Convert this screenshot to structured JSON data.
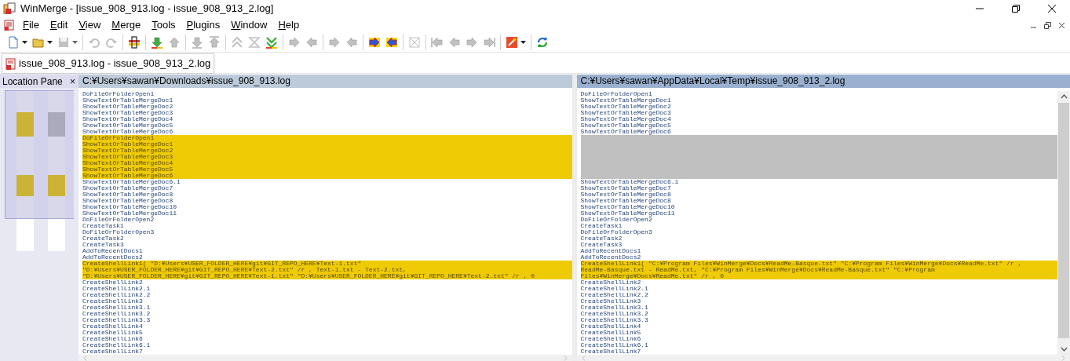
{
  "window": {
    "title": "WinMerge - [issue_908_913.log - issue_908_913_2.log]"
  },
  "menu": [
    {
      "label": "File"
    },
    {
      "label": "Edit"
    },
    {
      "label": "View"
    },
    {
      "label": "Merge"
    },
    {
      "label": "Tools"
    },
    {
      "label": "Plugins"
    },
    {
      "label": "Window"
    },
    {
      "label": "Help"
    }
  ],
  "toolbar": [
    {
      "kind": "new",
      "disabled": false,
      "dropdown": true
    },
    {
      "kind": "open",
      "disabled": false,
      "dropdown": true
    },
    {
      "kind": "save",
      "disabled": true,
      "dropdown": true
    },
    {
      "kind": "separator"
    },
    {
      "kind": "undo",
      "disabled": true
    },
    {
      "kind": "redo",
      "disabled": true
    },
    {
      "kind": "separator"
    },
    {
      "kind": "options",
      "disabled": false
    },
    {
      "kind": "separator"
    },
    {
      "kind": "next-diff",
      "disabled": false
    },
    {
      "kind": "prev-diff",
      "disabled": true
    },
    {
      "kind": "separator"
    },
    {
      "kind": "last-diff",
      "disabled": true
    },
    {
      "kind": "first-diff",
      "disabled": true
    },
    {
      "kind": "separator"
    },
    {
      "kind": "prev-conflict",
      "disabled": true
    },
    {
      "kind": "current-diff",
      "disabled": true
    },
    {
      "kind": "next-conflict",
      "disabled": false
    },
    {
      "kind": "separator"
    },
    {
      "kind": "copy-right",
      "disabled": true
    },
    {
      "kind": "copy-left",
      "disabled": true
    },
    {
      "kind": "separator"
    },
    {
      "kind": "copy-right-advance",
      "disabled": true
    },
    {
      "kind": "copy-left-advance",
      "disabled": true
    },
    {
      "kind": "separator"
    },
    {
      "kind": "all-right",
      "disabled": false
    },
    {
      "kind": "all-left",
      "disabled": false
    },
    {
      "kind": "separator"
    },
    {
      "kind": "merge",
      "disabled": true
    },
    {
      "kind": "separator"
    },
    {
      "kind": "first-file",
      "disabled": true
    },
    {
      "kind": "prev-file",
      "disabled": true
    },
    {
      "kind": "next-file",
      "disabled": true
    },
    {
      "kind": "last-file",
      "disabled": true
    },
    {
      "kind": "separator"
    },
    {
      "kind": "settings",
      "disabled": false,
      "dropdown": true
    },
    {
      "kind": "separator"
    },
    {
      "kind": "refresh",
      "disabled": false
    }
  ],
  "tabs": [
    {
      "label": "issue_908_913.log - issue_908_913_2.log",
      "selected": true
    }
  ],
  "location_pane": {
    "title": "Location Pane",
    "close": "×"
  },
  "panes": [
    {
      "path": "C:¥Users¥sawan¥Downloads¥issue_908_913.log",
      "active": false,
      "lines": [
        {
          "kind": "same",
          "text": "DoFileOrFolderOpen1"
        },
        {
          "kind": "same",
          "text": "ShowTextOrTableMergeDoc1"
        },
        {
          "kind": "same",
          "text": "ShowTextOrTableMergeDoc2"
        },
        {
          "kind": "same",
          "text": "ShowTextOrTableMergeDoc3"
        },
        {
          "kind": "same",
          "text": "ShowTextOrTableMergeDoc4"
        },
        {
          "kind": "same",
          "text": "ShowTextOrTableMergeDoc5"
        },
        {
          "kind": "same",
          "text": "ShowTextOrTableMergeDoc6"
        },
        {
          "kind": "diff",
          "text": "DoFileOrFolderOpen1"
        },
        {
          "kind": "diff",
          "text": "ShowTextOrTableMergeDoc1"
        },
        {
          "kind": "diff",
          "text": "ShowTextOrTableMergeDoc2"
        },
        {
          "kind": "diff",
          "text": "ShowTextOrTableMergeDoc3"
        },
        {
          "kind": "diff",
          "text": "ShowTextOrTableMergeDoc4"
        },
        {
          "kind": "diff",
          "text": "ShowTextOrTableMergeDoc5"
        },
        {
          "kind": "diff",
          "text": "ShowTextOrTableMergeDoc6"
        },
        {
          "kind": "same",
          "text": "ShowTextOrTableMergeDoc6.1"
        },
        {
          "kind": "same",
          "text": "ShowTextOrTableMergeDoc7"
        },
        {
          "kind": "same",
          "text": "ShowTextOrTableMergeDoc8"
        },
        {
          "kind": "same",
          "text": "ShowTextOrTableMergeDoc8"
        },
        {
          "kind": "same",
          "text": "ShowTextOrTableMergeDoc10"
        },
        {
          "kind": "same",
          "text": "ShowTextOrTableMergeDoc11"
        },
        {
          "kind": "same",
          "text": "DoFileOrFolderOpen2"
        },
        {
          "kind": "same",
          "text": "CreateTask1"
        },
        {
          "kind": "same",
          "text": "DoFileOrFolderOpen3"
        },
        {
          "kind": "same",
          "text": "CreateTask2"
        },
        {
          "kind": "same",
          "text": "CreateTask3"
        },
        {
          "kind": "same",
          "text": "AddToRecentDocs1"
        },
        {
          "kind": "same",
          "text": "AddToRecentDocs2"
        },
        {
          "kind": "diff",
          "text": "CreateShellLink1( \"D:¥Users¥USER_FOLDER_HERE¥git¥GIT_REPO_HERE¥Text-1.txt\""
        },
        {
          "kind": "diff",
          "text": "\"D:¥Users¥USER_FOLDER_HERE¥git¥GIT_REPO_HERE¥Text-2.txt\" /r , Text-1.txt - Text-2.txt,"
        },
        {
          "kind": "diff",
          "text": "\"D:¥Users¥USER_FOLDER_HERE¥git¥GIT_REPO_HERE¥Text-1.txt\" \"D:¥Users¥USER_FOLDER_HERE¥git¥GIT_REPO_HERE¥Text-2.txt\" /r , 0"
        },
        {
          "kind": "same",
          "text": "CreateShellLink2"
        },
        {
          "kind": "same",
          "text": "CreateShellLink2.1"
        },
        {
          "kind": "same",
          "text": "CreateShellLink2.2"
        },
        {
          "kind": "same",
          "text": "CreateShellLink3"
        },
        {
          "kind": "same",
          "text": "CreateShellLink3.1"
        },
        {
          "kind": "same",
          "text": "CreateShellLink3.2"
        },
        {
          "kind": "same",
          "text": "CreateShellLink3.3"
        },
        {
          "kind": "same",
          "text": "CreateShellLink4"
        },
        {
          "kind": "same",
          "text": "CreateShellLink5"
        },
        {
          "kind": "same",
          "text": "CreateShellLink6"
        },
        {
          "kind": "same",
          "text": "CreateShellLink6.1"
        },
        {
          "kind": "same",
          "text": "CreateShellLink7"
        }
      ]
    },
    {
      "path": "C:¥Users¥sawan¥AppData¥Local¥Temp¥issue_908_913_2.log",
      "active": true,
      "lines": [
        {
          "kind": "same",
          "text": "DoFileOrFolderOpen1"
        },
        {
          "kind": "same",
          "text": "ShowTextOrTableMergeDoc1"
        },
        {
          "kind": "same",
          "text": "ShowTextOrTableMergeDoc2"
        },
        {
          "kind": "same",
          "text": "ShowTextOrTableMergeDoc3"
        },
        {
          "kind": "same",
          "text": "ShowTextOrTableMergeDoc4"
        },
        {
          "kind": "same",
          "text": "ShowTextOrTableMergeDoc5"
        },
        {
          "kind": "same",
          "text": "ShowTextOrTableMergeDoc6"
        },
        {
          "kind": "ghost"
        },
        {
          "kind": "ghost"
        },
        {
          "kind": "ghost"
        },
        {
          "kind": "ghost"
        },
        {
          "kind": "ghost"
        },
        {
          "kind": "ghost"
        },
        {
          "kind": "ghost"
        },
        {
          "kind": "same",
          "text": "ShowTextOrTableMergeDoc6.1"
        },
        {
          "kind": "same",
          "text": "ShowTextOrTableMergeDoc7"
        },
        {
          "kind": "same",
          "text": "ShowTextOrTableMergeDoc8"
        },
        {
          "kind": "same",
          "text": "ShowTextOrTableMergeDoc8"
        },
        {
          "kind": "same",
          "text": "ShowTextOrTableMergeDoc10"
        },
        {
          "kind": "same",
          "text": "ShowTextOrTableMergeDoc11"
        },
        {
          "kind": "same",
          "text": "DoFileOrFolderOpen2"
        },
        {
          "kind": "same",
          "text": "CreateTask1"
        },
        {
          "kind": "same",
          "text": "DoFileOrFolderOpen3"
        },
        {
          "kind": "same",
          "text": "CreateTask2"
        },
        {
          "kind": "same",
          "text": "CreateTask3"
        },
        {
          "kind": "same",
          "text": "AddToRecentDocs1"
        },
        {
          "kind": "same",
          "text": "AddToRecentDocs2"
        },
        {
          "kind": "diff",
          "text": "CreateShellLink1( \"C:¥Program Files¥WinMerge¥Docs¥ReadMe-Basque.txt\" \"C:¥Program Files¥WinMerge¥Docs¥ReadMe.txt\" /r ,"
        },
        {
          "kind": "diff",
          "text": "ReadMe-Basque.txt - ReadMe.txt, \"C:¥Program Files¥WinMerge¥Docs¥ReadMe-Basque.txt\" \"C:¥Program"
        },
        {
          "kind": "diff",
          "text": "Files¥WinMerge¥Docs¥ReadMe.txt\" /r , 0"
        },
        {
          "kind": "same",
          "text": "CreateShellLink2"
        },
        {
          "kind": "same",
          "text": "CreateShellLink2.1"
        },
        {
          "kind": "same",
          "text": "CreateShellLink2.2"
        },
        {
          "kind": "same",
          "text": "CreateShellLink3"
        },
        {
          "kind": "same",
          "text": "CreateShellLink3.1"
        },
        {
          "kind": "same",
          "text": "CreateShellLink3.2"
        },
        {
          "kind": "same",
          "text": "CreateShellLink3.3"
        },
        {
          "kind": "same",
          "text": "CreateShellLink4"
        },
        {
          "kind": "same",
          "text": "CreateShellLink5"
        },
        {
          "kind": "same",
          "text": "CreateShellLink6"
        },
        {
          "kind": "same",
          "text": "CreateShellLink6.1"
        },
        {
          "kind": "same",
          "text": "CreateShellLink7"
        }
      ]
    }
  ]
}
